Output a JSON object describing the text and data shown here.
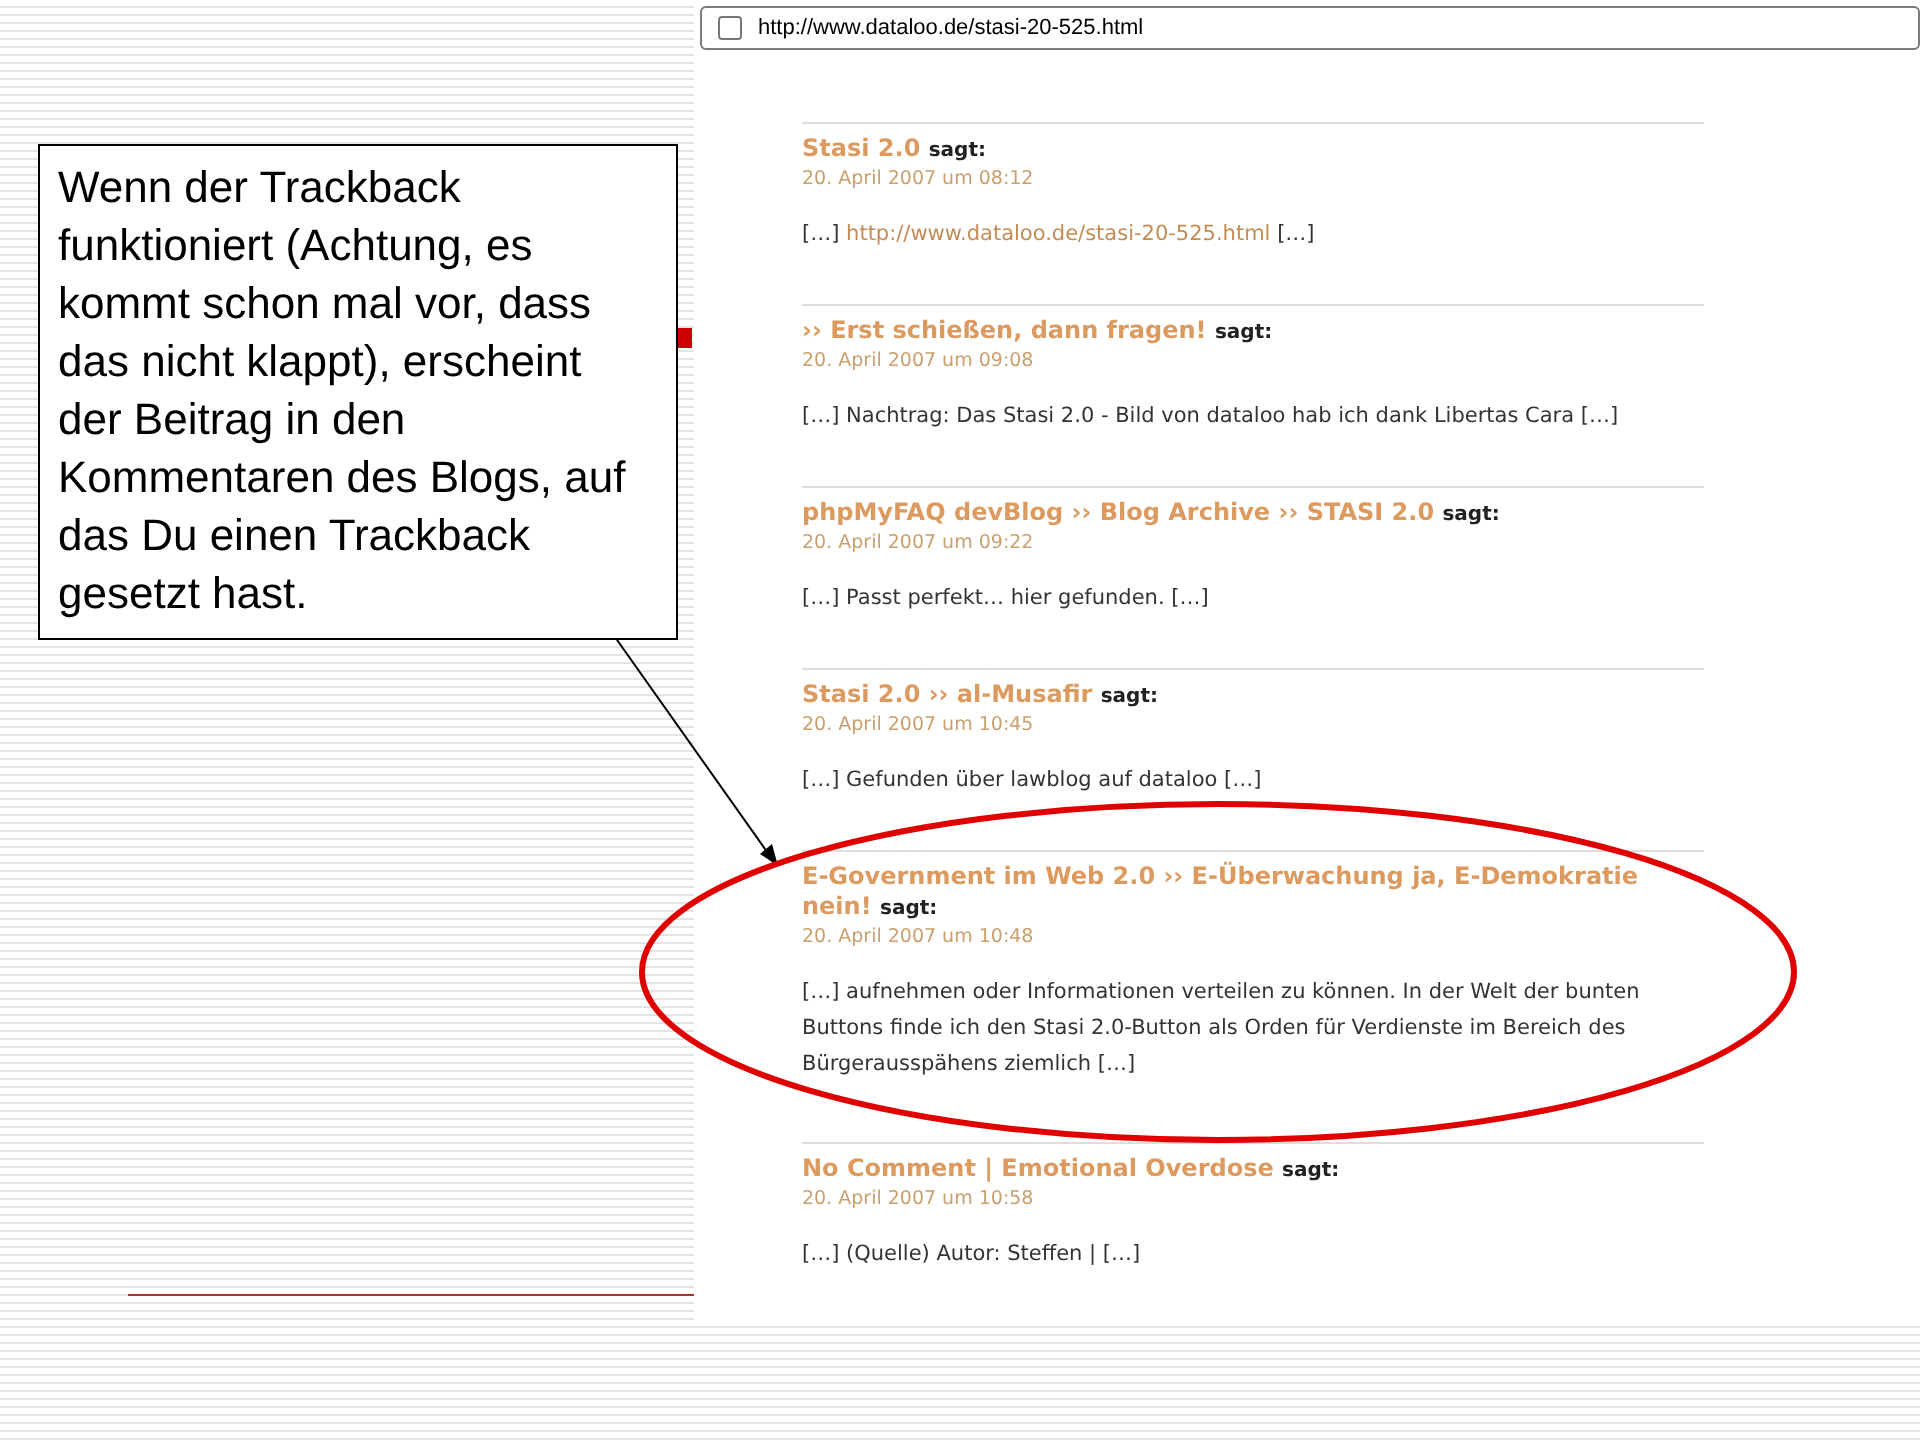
{
  "callout": {
    "text": "Wenn der Trackback funktioniert (Achtung, es kommt schon mal vor, dass das nicht klappt), erscheint der Beitrag in den Kommentaren des Blogs, auf das Du einen Trackback gesetzt hast."
  },
  "browser": {
    "address": "http://www.dataloo.de/stasi-20-525.html"
  },
  "comments": [
    {
      "title": "Stasi 2.0",
      "says": "sagt:",
      "date": "20. April 2007 um 08:12",
      "highlighted": false,
      "body": [
        {
          "kind": "text",
          "text": "[…]"
        },
        {
          "kind": "link",
          "text": "http://www.dataloo.de/stasi-20-525.html"
        },
        {
          "kind": "text",
          "text": "[…]"
        }
      ]
    },
    {
      "title": "›› Erst schießen, dann fragen!",
      "says": "sagt:",
      "date": "20. April 2007 um 09:08",
      "highlighted": false,
      "body": [
        {
          "kind": "text",
          "text": "[…] Nachtrag: Das Stasi 2.0 - Bild von dataloo hab ich dank Libertas Cara […]"
        }
      ]
    },
    {
      "title": "phpMyFAQ devBlog ›› Blog Archive ›› STASI 2.0",
      "says": "sagt:",
      "date": "20. April 2007 um 09:22",
      "highlighted": false,
      "body": [
        {
          "kind": "text",
          "text": "[…] Passt perfekt… hier gefunden. […]"
        }
      ]
    },
    {
      "title": "Stasi 2.0 ›› al-Musafir",
      "says": "sagt:",
      "date": "20. April 2007 um 10:45",
      "highlighted": false,
      "body": [
        {
          "kind": "text",
          "text": "[…] Gefunden über lawblog auf dataloo […]"
        }
      ]
    },
    {
      "title": "E-Government im Web 2.0 ›› E-Überwachung ja, E-Demokratie nein!",
      "says": "sagt:",
      "date": "20. April 2007 um 10:48",
      "highlighted": true,
      "body": [
        {
          "kind": "text",
          "text": "[…] aufnehmen oder Informationen verteilen zu können. In der Welt der bunten Buttons finde ich den Stasi 2.0-Button als Orden für Verdienste im Bereich des Bürgerausspähens ziemlich […]"
        }
      ]
    },
    {
      "title": "No Comment | Emotional Overdose",
      "says": "sagt:",
      "date": "20. April 2007 um 10:58",
      "highlighted": false,
      "body": [
        {
          "kind": "text",
          "text": "[…] (Quelle) Autor: Steffen | […]"
        }
      ]
    }
  ]
}
